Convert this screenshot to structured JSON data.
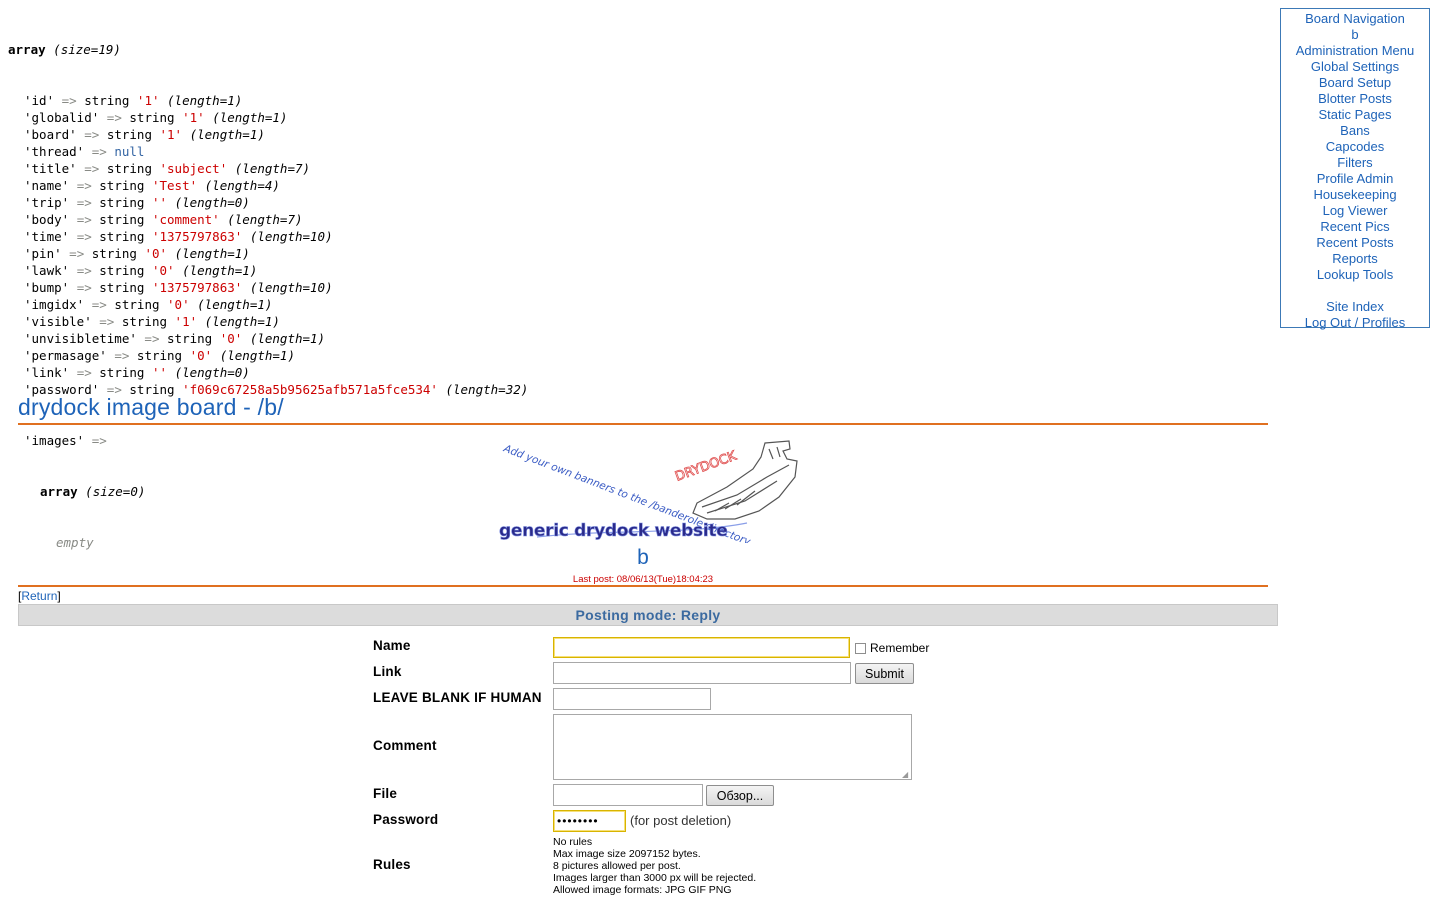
{
  "dump": {
    "header_kw": "array",
    "header_meta": "(size=19)",
    "fields": [
      {
        "key": "'id'",
        "arrow": "=>",
        "type": "string",
        "value": "'1'",
        "meta": "(length=1)"
      },
      {
        "key": "'globalid'",
        "arrow": "=>",
        "type": "string",
        "value": "'1'",
        "meta": "(length=1)"
      },
      {
        "key": "'board'",
        "arrow": "=>",
        "type": "string",
        "value": "'1'",
        "meta": "(length=1)"
      },
      {
        "key": "'thread'",
        "arrow": "=>",
        "type": "",
        "value": "null",
        "meta": "",
        "is_null": true
      },
      {
        "key": "'title'",
        "arrow": "=>",
        "type": "string",
        "value": "'subject'",
        "meta": "(length=7)"
      },
      {
        "key": "'name'",
        "arrow": "=>",
        "type": "string",
        "value": "'Test'",
        "meta": "(length=4)"
      },
      {
        "key": "'trip'",
        "arrow": "=>",
        "type": "string",
        "value": "''",
        "meta": "(length=0)"
      },
      {
        "key": "'body'",
        "arrow": "=>",
        "type": "string",
        "value": "'comment'",
        "meta": "(length=7)"
      },
      {
        "key": "'time'",
        "arrow": "=>",
        "type": "string",
        "value": "'1375797863'",
        "meta": "(length=10)"
      },
      {
        "key": "'pin'",
        "arrow": "=>",
        "type": "string",
        "value": "'0'",
        "meta": "(length=1)"
      },
      {
        "key": "'lawk'",
        "arrow": "=>",
        "type": "string",
        "value": "'0'",
        "meta": "(length=1)"
      },
      {
        "key": "'bump'",
        "arrow": "=>",
        "type": "string",
        "value": "'1375797863'",
        "meta": "(length=10)"
      },
      {
        "key": "'imgidx'",
        "arrow": "=>",
        "type": "string",
        "value": "'0'",
        "meta": "(length=1)"
      },
      {
        "key": "'visible'",
        "arrow": "=>",
        "type": "string",
        "value": "'1'",
        "meta": "(length=1)"
      },
      {
        "key": "'unvisibletime'",
        "arrow": "=>",
        "type": "string",
        "value": "'0'",
        "meta": "(length=1)"
      },
      {
        "key": "'permasage'",
        "arrow": "=>",
        "type": "string",
        "value": "'0'",
        "meta": "(length=1)"
      },
      {
        "key": "'link'",
        "arrow": "=>",
        "type": "string",
        "value": "''",
        "meta": "(length=0)"
      },
      {
        "key": "'password'",
        "arrow": "=>",
        "type": "string",
        "value": "'f069c67258a5b95625afb571a5fce534'",
        "meta": "(length=32)"
      }
    ],
    "images_key": "'images'",
    "images_arrow": "=>",
    "nested_kw": "array",
    "nested_meta": "(size=0)",
    "empty_label": "empty"
  },
  "nav": {
    "items_top": [
      "Board Navigation",
      "b",
      "Administration Menu",
      "Global Settings",
      "Board Setup",
      "Blotter Posts",
      "Static Pages",
      "Bans",
      "Capcodes",
      "Filters",
      "Profile Admin",
      "Housekeeping",
      "Log Viewer",
      "Recent Pics",
      "Recent Posts",
      "Reports",
      "Lookup Tools"
    ],
    "site_index": "Site Index",
    "log_out": "Log Out",
    "separator": "/",
    "profiles": "Profiles",
    "link_color": "#1e63b8"
  },
  "header": {
    "title": "drydock image board - /b/",
    "banner_text_top": "Add your own banners to the /banderole directory",
    "banner_text_main": "generic drydock website",
    "banner_text_logo": "DRYDOCK",
    "board_letter": "b",
    "last_post": "Last post: 08/06/13(Tue)18:04:23"
  },
  "return": {
    "open": "[",
    "label": "Return",
    "close": "]"
  },
  "posting_mode": "Posting mode: Reply",
  "form": {
    "name_label": "Name",
    "name_value": "",
    "remember_label": "Remember",
    "link_label": "Link",
    "link_value": "",
    "submit_label": "Submit",
    "honeypot_label": "LEAVE BLANK IF HUMAN",
    "honeypot_value": "",
    "comment_label": "Comment",
    "comment_value": "",
    "file_label": "File",
    "browse_label": "Обзор...",
    "password_label": "Password",
    "password_value": "••••••••",
    "password_hint": "(for post deletion)",
    "rules_label": "Rules",
    "rules": [
      "No rules",
      "Max image size 2097152 bytes.",
      "8 pictures allowed per post.",
      "Images larger than 3000 px will be rejected.",
      "Allowed image formats: JPG GIF PNG"
    ]
  }
}
